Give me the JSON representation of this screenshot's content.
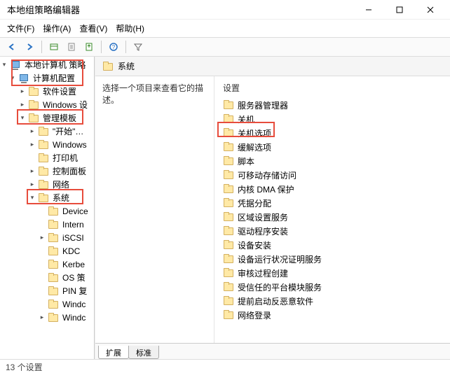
{
  "window": {
    "title": "本地组策略编辑器"
  },
  "menu": {
    "file": "文件(F)",
    "action": "操作(A)",
    "view": "查看(V)",
    "help": "帮助(H)"
  },
  "tree": {
    "root": "本地计算机 策略",
    "computer_config": "计算机配置",
    "software_settings": "软件设置",
    "windows_settings": "Windows 设",
    "admin_templates": "管理模板",
    "start_menu": "\"开始\"菜单",
    "windows": "Windows",
    "printers": "打印机",
    "control_panel": "控制面板",
    "network": "网络",
    "system": "系统",
    "device": "Device",
    "intern": "Intern",
    "iscsi": "iSCSI",
    "kdc": "KDC",
    "kerbe": "Kerbe",
    "os_policy": "OS 策",
    "pin_complex": "PIN 复",
    "windc": "Windc",
    "windc2": "Windc"
  },
  "content": {
    "header": "系统",
    "prompt": "选择一个项目来查看它的描述。",
    "settings_header": "设置",
    "items": [
      "服务器管理器",
      "关机",
      "关机选项",
      "缓解选项",
      "脚本",
      "可移动存储访问",
      "内核 DMA 保护",
      "凭据分配",
      "区域设置服务",
      "驱动程序安装",
      "设备安装",
      "设备运行状况证明服务",
      "审核过程创建",
      "受信任的平台模块服务",
      "提前启动反恶意软件",
      "网络登录"
    ]
  },
  "tabs": {
    "extended": "扩展",
    "standard": "标准"
  },
  "status": "13 个设置"
}
